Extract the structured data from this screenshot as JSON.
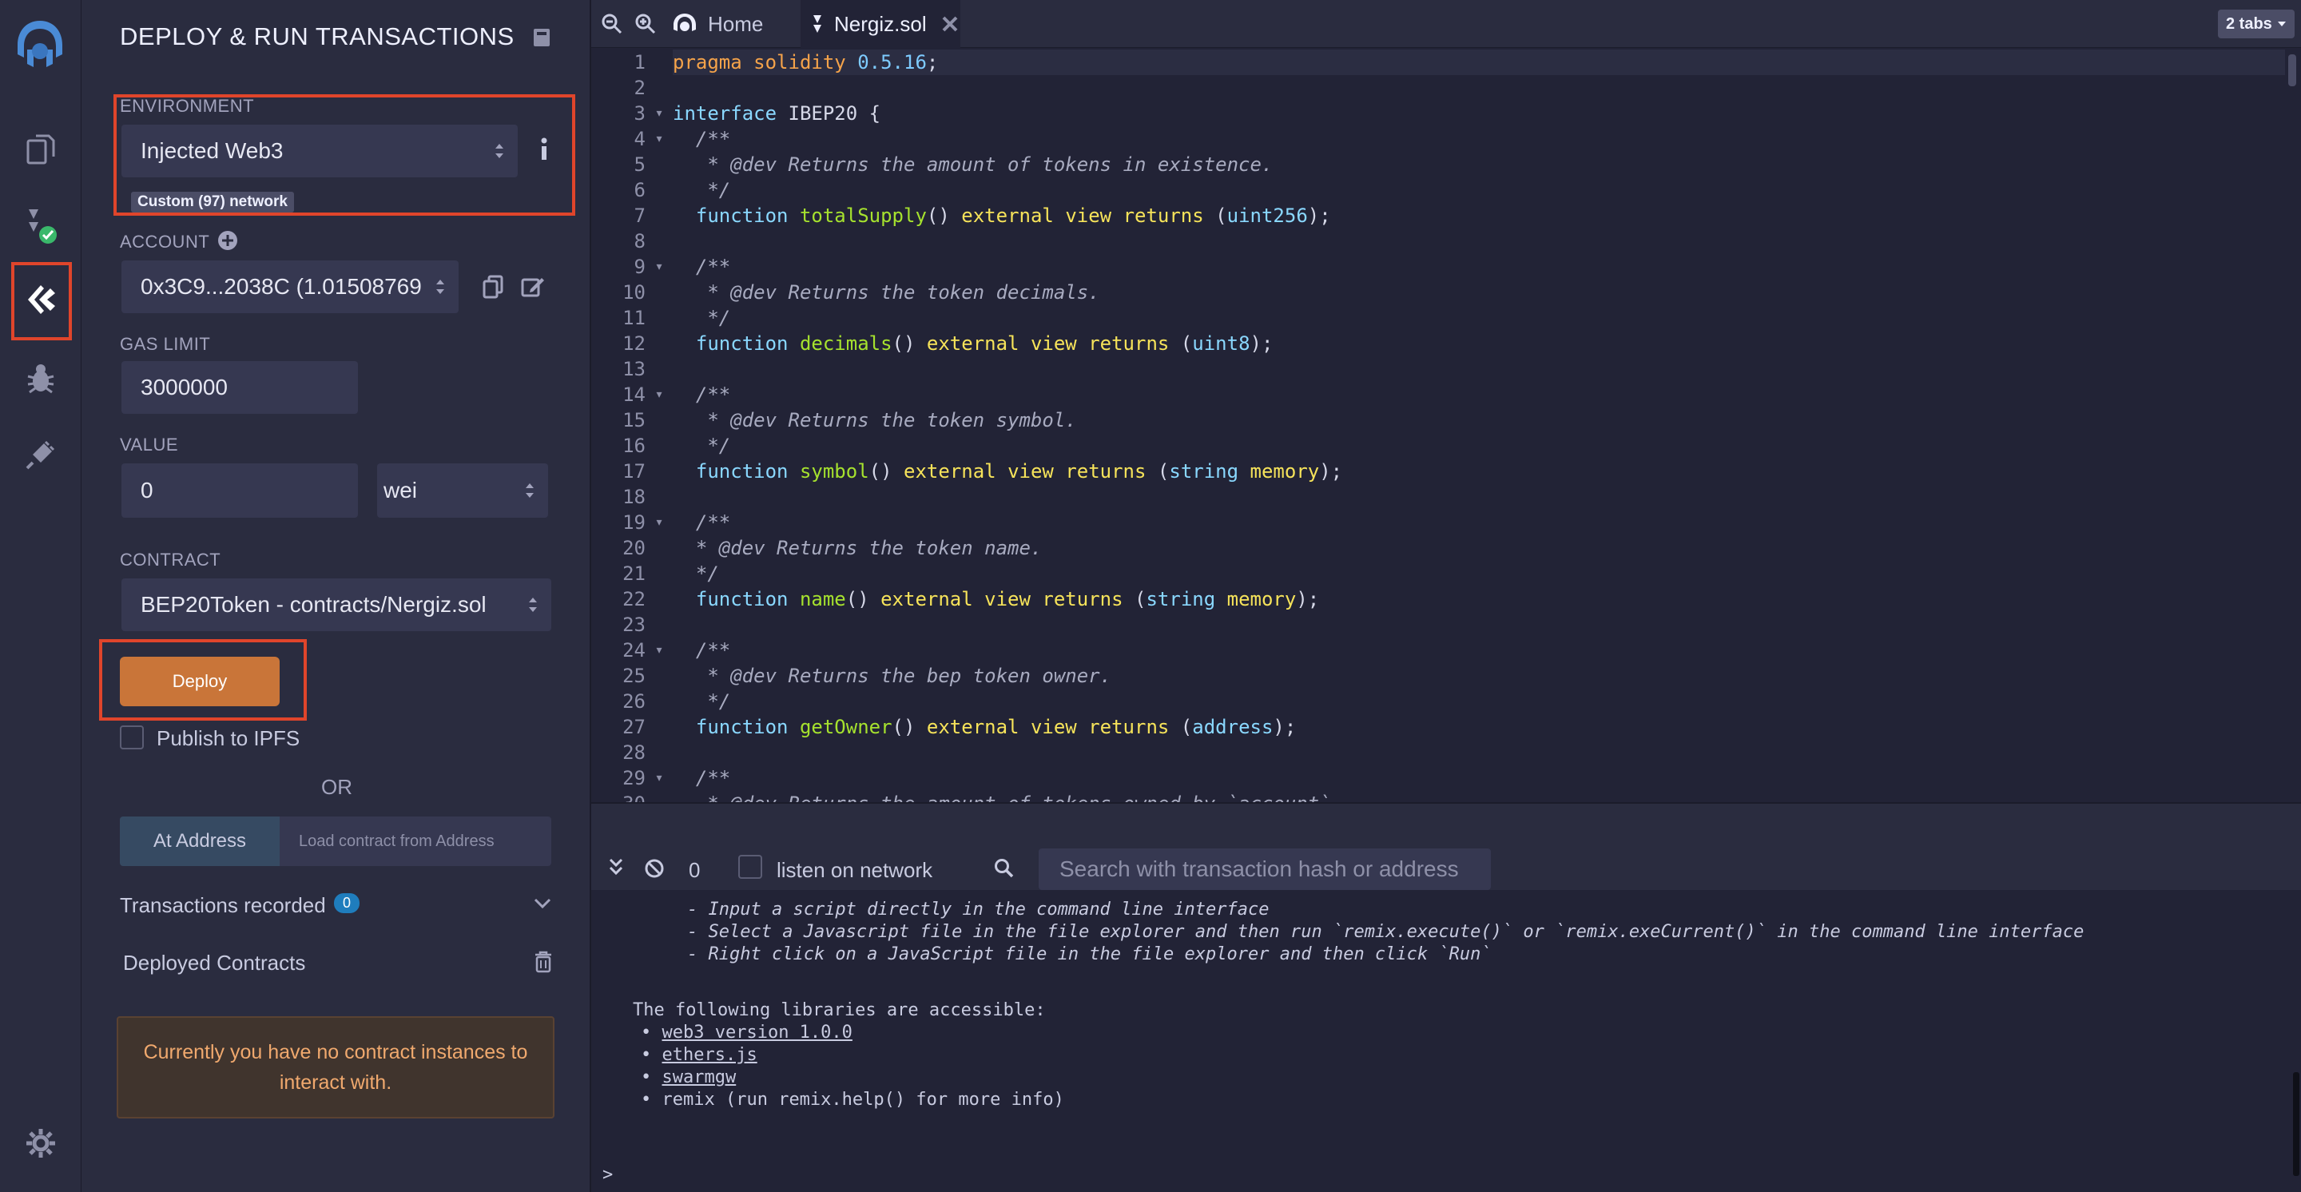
{
  "sidebar": {
    "title": "DEPLOY & RUN TRANSACTIONS",
    "environment": {
      "label": "ENVIRONMENT",
      "value": "Injected Web3",
      "network_badge": "Custom (97) network"
    },
    "account": {
      "label": "ACCOUNT",
      "value": "0x3C9...2038C (1.01508769"
    },
    "gas_limit": {
      "label": "GAS LIMIT",
      "value": "3000000"
    },
    "value": {
      "label": "VALUE",
      "amount": "0",
      "unit": "wei"
    },
    "contract": {
      "label": "CONTRACT",
      "value": "BEP20Token - contracts/Nergiz.sol"
    },
    "deploy_label": "Deploy",
    "publish_label": "Publish to IPFS",
    "or_label": "OR",
    "at_address_label": "At Address",
    "load_placeholder": "Load contract from Address",
    "transactions_recorded": {
      "label": "Transactions recorded",
      "count": "0"
    },
    "deployed_contracts_label": "Deployed Contracts",
    "no_instances_message": "Currently you have no contract instances to interact with."
  },
  "tabs": {
    "home_label": "Home",
    "file_label": "Nergiz.sol",
    "count_label": "2 tabs"
  },
  "code": [
    "pragma solidity 0.5.16;",
    "",
    "interface IBEP20 {",
    "  /**",
    "   * @dev Returns the amount of tokens in existence.",
    "   */",
    "  function totalSupply() external view returns (uint256);",
    "",
    "  /**",
    "   * @dev Returns the token decimals.",
    "   */",
    "  function decimals() external view returns (uint8);",
    "",
    "  /**",
    "   * @dev Returns the token symbol.",
    "   */",
    "  function symbol() external view returns (string memory);",
    "",
    "  /**",
    "  * @dev Returns the token name.",
    "  */",
    "  function name() external view returns (string memory);",
    "",
    "  /**",
    "   * @dev Returns the bep token owner.",
    "   */",
    "  function getOwner() external view returns (address);",
    "",
    "  /**",
    "   * @dev Returns the amount of tokens owned by `account`."
  ],
  "terminal": {
    "pending_count": "0",
    "listen_label": "listen on network",
    "search_placeholder": "Search with transaction hash or address",
    "lines": [
      "- Input a script directly in the command line interface",
      "- Select a Javascript file in the file explorer and then run `remix.execute()` or `remix.exeCurrent()` in the command line interface",
      "- Right click on a JavaScript file in the file explorer and then click `Run`"
    ],
    "libraries_heading": "The following libraries are accessible:",
    "libraries": [
      "web3 version 1.0.0",
      "ethers.js",
      "swarmgw"
    ],
    "remix_item": "remix (run remix.help() for more info)",
    "prompt": ">"
  },
  "colors": {
    "accent": "#c97539",
    "highlight": "#e0452b",
    "badge": "#1f7dbd"
  }
}
